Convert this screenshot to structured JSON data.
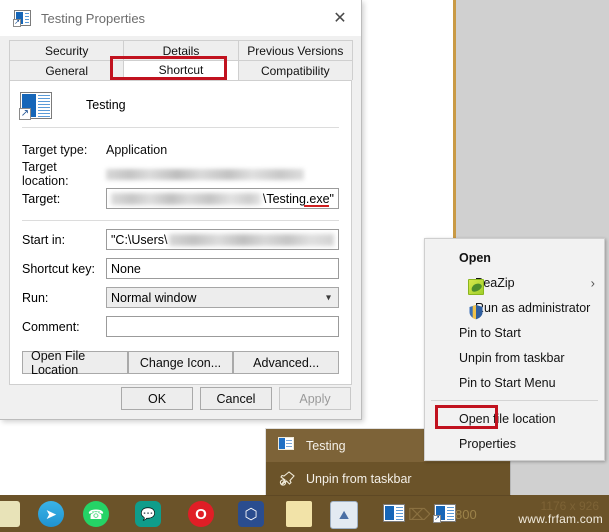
{
  "desktop": {
    "background_color": "#d0d0d0",
    "background_window_border_color": "#c99a45"
  },
  "dialog": {
    "title": "Testing Properties",
    "title_icon": "shortcut-window-icon",
    "close_label": "✕",
    "tabs_row1": [
      {
        "label": "Security",
        "selected": false
      },
      {
        "label": "Details",
        "selected": false
      },
      {
        "label": "Previous Versions",
        "selected": false
      }
    ],
    "tabs_row2": [
      {
        "label": "General",
        "selected": false
      },
      {
        "label": "Shortcut",
        "selected": true
      },
      {
        "label": "Compatibility",
        "selected": false
      }
    ],
    "shortcut_tab": {
      "item_name": "Testing",
      "item_icon": "shortcut-window-icon",
      "fields": {
        "target_type_label": "Target type:",
        "target_type_value": "Application",
        "target_location_label": "Target location:",
        "target_location_value": "",
        "target_label": "Target:",
        "target_value_suffix": "\\Testing.exe\"",
        "start_in_label": "Start in:",
        "start_in_value": "\"C:\\Users\\",
        "shortcut_key_label": "Shortcut key:",
        "shortcut_key_value": "None",
        "run_label": "Run:",
        "run_value": "Normal window",
        "comment_label": "Comment:",
        "comment_value": ""
      },
      "buttons": [
        {
          "label": "Open File Location"
        },
        {
          "label": "Change Icon..."
        },
        {
          "label": "Advanced..."
        }
      ]
    },
    "footer_buttons": [
      {
        "label": "OK",
        "disabled": false
      },
      {
        "label": "Cancel",
        "disabled": false
      },
      {
        "label": "Apply",
        "disabled": true
      }
    ]
  },
  "context_menu": {
    "items": [
      {
        "label": "Open",
        "bold": true,
        "icon": null,
        "submenu": false
      },
      {
        "label": "PeaZip",
        "bold": false,
        "icon": "peazip-icon",
        "submenu": true
      },
      {
        "label": "Run as administrator",
        "bold": false,
        "icon": "shield-icon",
        "submenu": false
      },
      {
        "label": "Pin to Start",
        "bold": false,
        "icon": null,
        "submenu": false
      },
      {
        "label": "Unpin from taskbar",
        "bold": false,
        "icon": null,
        "submenu": false
      },
      {
        "label": "Pin to Start Menu",
        "bold": false,
        "icon": null,
        "submenu": false
      },
      {
        "separator": true
      },
      {
        "label": "Open file location",
        "bold": false,
        "icon": null,
        "submenu": false
      },
      {
        "label": "Properties",
        "bold": false,
        "icon": null,
        "submenu": false,
        "highlighted": true
      }
    ],
    "submenu_arrow": "›"
  },
  "jump_list": {
    "background_color": "#6b5329",
    "items": [
      {
        "label": "Testing",
        "icon": "document-icon",
        "highlighted": true
      },
      {
        "label": "Unpin from taskbar",
        "icon": "unpin-icon",
        "highlighted": false
      }
    ]
  },
  "taskbar": {
    "background_color": "#6b5329",
    "watermark": "www.frfam.com",
    "ghost_text_dimension": "1176 x 926",
    "ghost_text_size": "800",
    "icons": [
      {
        "name": "app-icon-partial",
        "color": "#e8e3b8"
      },
      {
        "name": "telegram-icon",
        "color": "#2aa3e0",
        "glyph": "➤"
      },
      {
        "name": "whatsapp-icon",
        "color": "#25d366",
        "glyph": "✆"
      },
      {
        "name": "messaging-icon",
        "color": "#0f9d8b",
        "glyph": "✉"
      },
      {
        "name": "opera-icon",
        "color": "#e01e26",
        "glyph": "O"
      },
      {
        "name": "virtualbox-icon",
        "color": "#2a4d8f",
        "glyph": "⬡"
      },
      {
        "name": "sticky-notes-icon",
        "color": "#f2e3a8",
        "glyph": ""
      },
      {
        "name": "photos-icon",
        "color": "#dfe6ee",
        "glyph": "⛰"
      },
      {
        "name": "document-icon",
        "color": "#ffffff",
        "glyph": ""
      },
      {
        "name": "shortcut-window-icon",
        "color": "#ffffff",
        "glyph": ""
      }
    ]
  },
  "annotations": {
    "color": "#c1121f",
    "boxes": [
      {
        "name": "shortcut-tab-highlight",
        "target": "Shortcut"
      },
      {
        "name": "properties-menu-highlight",
        "target": "Properties"
      }
    ]
  }
}
